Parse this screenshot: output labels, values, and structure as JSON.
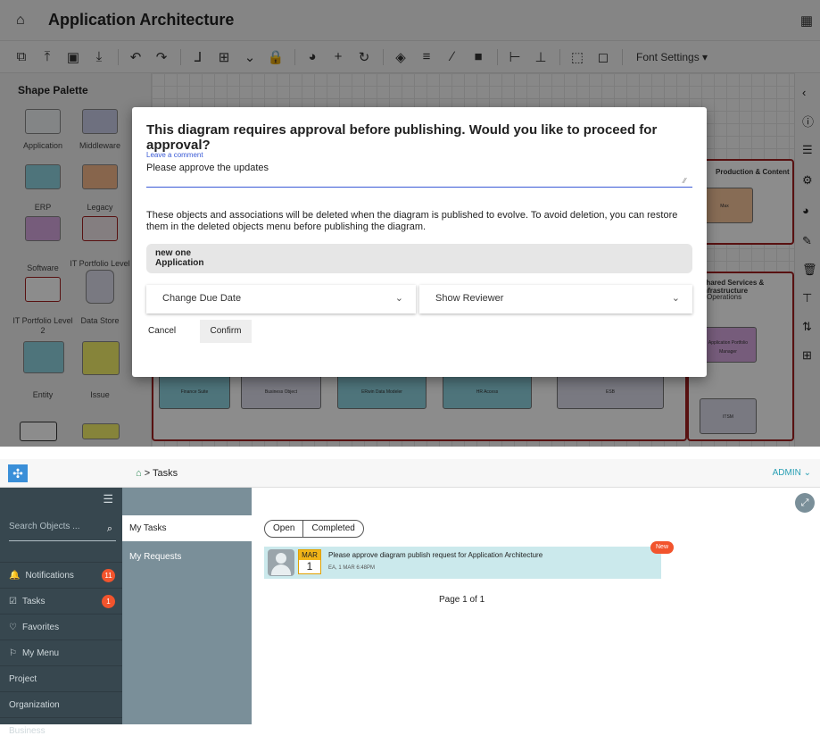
{
  "editor": {
    "title": "Application Architecture",
    "toolbar_font_settings": "Font Settings ▾",
    "palette_title": "Shape Palette",
    "palette_items": [
      "Application",
      "Middleware",
      "ERP",
      "Legacy",
      "Software",
      "IT Portfolio Level 1",
      "IT Portfolio Level 2",
      "Data Store",
      "Entity",
      "Issue"
    ],
    "canvas_blocks": [
      "Production & Content",
      "Shared Services & Infrastructure",
      "Operations"
    ],
    "canvas_nodes": [
      "Finance Suite",
      "Business Object",
      "ERwin Data Modeler",
      "HR Access",
      "ESB",
      "ITSM",
      "Application Portfolio Manager",
      "Max"
    ]
  },
  "dialog": {
    "title": "This diagram requires approval before publishing. Would you like to proceed for approval?",
    "comment_label": "Leave a comment",
    "comment_value": "Please approve the updates",
    "warning": "These objects and associations will be deleted when the diagram is published to evolve. To avoid deletion, you can restore them in the deleted objects menu before publishing the diagram.",
    "deleted_objects": [
      "new one",
      "Application"
    ],
    "dropdown_due_date": "Change Due Date",
    "dropdown_reviewer": "Show Reviewer",
    "cancel": "Cancel",
    "confirm": "Confirm"
  },
  "tasks_app": {
    "breadcrumb": "Tasks",
    "user": "ADMIN",
    "search_placeholder": "Search Objects ...",
    "nav": [
      {
        "label": "Notifications",
        "badge": "11"
      },
      {
        "label": "Tasks",
        "badge": "1"
      },
      {
        "label": "Favorites"
      },
      {
        "label": "My Menu"
      },
      {
        "label": "Project"
      },
      {
        "label": "Organization"
      },
      {
        "label": "Business"
      }
    ],
    "subnav": [
      "My Tasks",
      "My Requests"
    ],
    "tabs": [
      "Open",
      "Completed"
    ],
    "task": {
      "month": "MAR",
      "day": "1",
      "title": "Please approve diagram publish request for Application Architecture",
      "meta": "EA, 1 MAR 6:48PM",
      "badge": "New"
    },
    "pager": "Page 1 of 1"
  }
}
